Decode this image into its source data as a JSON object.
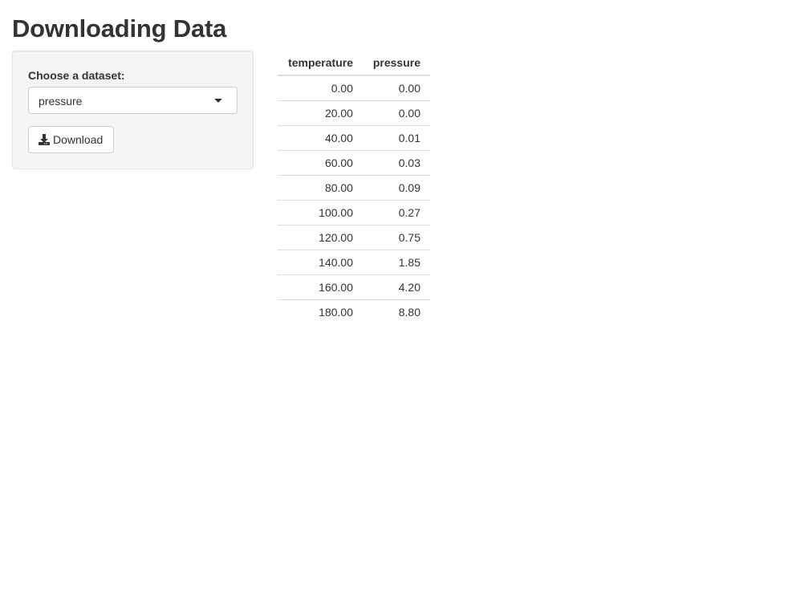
{
  "page": {
    "title": "Downloading Data"
  },
  "sidebar": {
    "dataset_label": "Choose a dataset:",
    "dataset_selected": "pressure",
    "download_label": "Download",
    "download_icon": "download-icon"
  },
  "table": {
    "columns": [
      "temperature",
      "pressure"
    ],
    "rows": [
      [
        "0.00",
        "0.00"
      ],
      [
        "20.00",
        "0.00"
      ],
      [
        "40.00",
        "0.01"
      ],
      [
        "60.00",
        "0.03"
      ],
      [
        "80.00",
        "0.09"
      ],
      [
        "100.00",
        "0.27"
      ],
      [
        "120.00",
        "0.75"
      ],
      [
        "140.00",
        "1.85"
      ],
      [
        "160.00",
        "4.20"
      ],
      [
        "180.00",
        "8.80"
      ]
    ]
  },
  "colors": {
    "text": "#333333",
    "panel_bg": "#f5f5f5",
    "border": "#cccccc",
    "table_rule": "#dddddd"
  }
}
